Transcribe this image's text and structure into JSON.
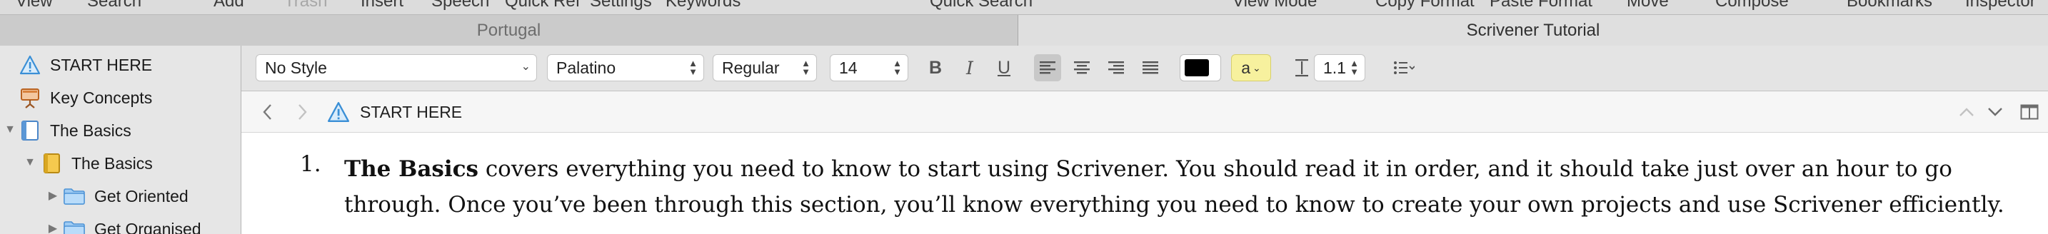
{
  "toolbar": {
    "items": [
      "View",
      "Search",
      "Add",
      "Trash",
      "Insert",
      "Speech",
      "Quick Ref",
      "Settings",
      "Keywords",
      "Quick Search",
      "View Mode",
      "Copy Format",
      "Paste Format",
      "Move",
      "Compose",
      "Bookmarks",
      "Inspector"
    ]
  },
  "tabs": [
    {
      "label": "Portugal",
      "active": false
    },
    {
      "label": "Scrivener Tutorial",
      "active": true
    }
  ],
  "binder": {
    "items": [
      {
        "label": "START HERE",
        "icon": "warning-icon",
        "level": 0,
        "disclosure": "none"
      },
      {
        "label": "Key Concepts",
        "icon": "presentation-icon",
        "level": 0,
        "disclosure": "none"
      },
      {
        "label": "The Basics",
        "icon": "document-icon",
        "level": 0,
        "disclosure": "expanded"
      },
      {
        "label": "The Basics",
        "icon": "notebook-icon",
        "level": 1,
        "disclosure": "expanded"
      },
      {
        "label": "Get Oriented",
        "icon": "folder-icon",
        "level": 2,
        "disclosure": "collapsed"
      },
      {
        "label": "Get Organised",
        "icon": "folder-icon",
        "level": 2,
        "disclosure": "collapsed"
      }
    ]
  },
  "format_bar": {
    "style": "No Style",
    "font": "Palatino",
    "weight": "Regular",
    "size": "14",
    "bold": "B",
    "italic": "I",
    "underline": "U",
    "alignment": "left",
    "text_color": "#000000",
    "highlight_label": "a",
    "highlight_color": "#f7f19e",
    "line_spacing": "1.1"
  },
  "header": {
    "title": "START HERE"
  },
  "editor": {
    "list_number": "1.",
    "bold_lead": "The Basics",
    "line1_rest": " covers everything you need to know to start using Scrivener. You should read it in order, and it should take just over an hour to go",
    "line2": "through. Once you’ve been through this section, you’ll know everything you need to know to create your own projects and use Scrivener efficiently."
  }
}
